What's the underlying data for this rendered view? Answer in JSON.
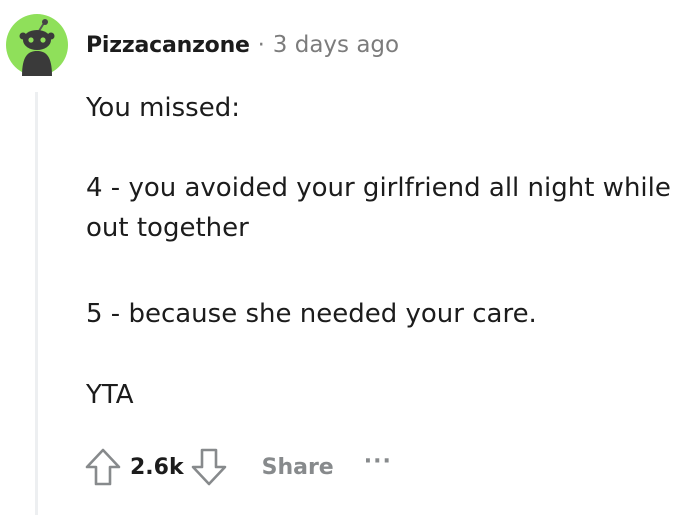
{
  "comment": {
    "author": "Pizzacanzone",
    "separator": "·",
    "time": "3 days ago",
    "paragraphs": [
      "You missed:",
      "4 - you avoided your girlfriend all night while out together",
      "5 - because she needed your care.",
      "YTA"
    ],
    "score": "2.6k",
    "share_label": "Share",
    "more_label": "···"
  },
  "colors": {
    "avatar_bg": "#8fe05a",
    "text": "#1c1c1c",
    "meta": "#7c7c7c",
    "action": "#878a8c"
  },
  "icons": {
    "avatar": "snoo-avatar-icon",
    "upvote": "upvote-arrow-icon",
    "downvote": "downvote-arrow-icon"
  }
}
